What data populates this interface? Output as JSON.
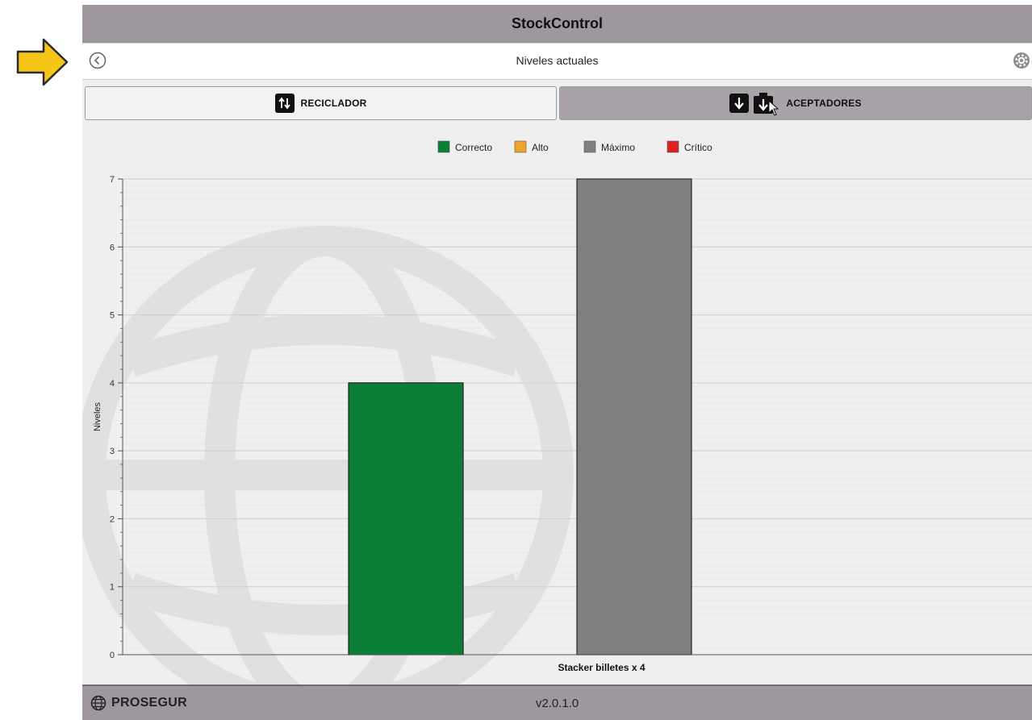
{
  "app": {
    "title": "StockControl"
  },
  "nav": {
    "title": "Niveles actuales",
    "back_icon": "back-arrow-circle-icon",
    "settings_icon": "gear-icon"
  },
  "tabs": [
    {
      "label": "RECICLADOR",
      "icon": "recycle-arrows-icon",
      "active": false
    },
    {
      "label": "ACEPTADORES",
      "icon": "deposit-arrow-icon",
      "active": true
    }
  ],
  "chart_data": {
    "type": "bar",
    "categories": [
      "Stacker billetes x 4"
    ],
    "series": [
      {
        "name": "Correcto",
        "values": [
          4
        ],
        "color": "#0a7f35"
      },
      {
        "name": "Alto",
        "values": [
          null
        ],
        "color": "#f0a32b"
      },
      {
        "name": "Máximo",
        "values": [
          7
        ],
        "color": "#808080"
      },
      {
        "name": "Crítico",
        "values": [
          null
        ],
        "color": "#e02020"
      }
    ],
    "title": "",
    "xlabel": "Stacker billetes x 4",
    "ylabel": "Niveles",
    "ylim": [
      0,
      7
    ],
    "yticks": [
      0,
      1,
      2,
      3,
      4,
      5,
      6,
      7
    ],
    "grid": true,
    "legend_position": "top-center"
  },
  "footer": {
    "brand": "PROSEGUR",
    "version": "v2.0.1.0"
  },
  "colors": {
    "header_bg": "#9e979e",
    "active_tab_bg": "#a9a2a9",
    "annotation_arrow": "#f5c518"
  }
}
